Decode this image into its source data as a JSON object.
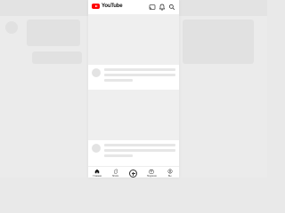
{
  "app": {
    "name": "YouTube"
  },
  "header": {
    "logo_text": "YouTube",
    "icons": [
      "cast-icon",
      "notifications-icon",
      "search-icon"
    ]
  },
  "bottom_nav": {
    "items": [
      {
        "label": "Главная",
        "icon": "home-icon"
      },
      {
        "label": "Shorts",
        "icon": "shorts-icon"
      },
      {
        "label": "",
        "icon": "create-icon"
      },
      {
        "label": "Подписки",
        "icon": "subscriptions-icon"
      },
      {
        "label": "Вы",
        "icon": "you-icon"
      }
    ]
  },
  "colors": {
    "brand_red": "#ff0000",
    "background": "#e9e9e9",
    "surface": "#ffffff",
    "placeholder": "#e6e6e6"
  }
}
